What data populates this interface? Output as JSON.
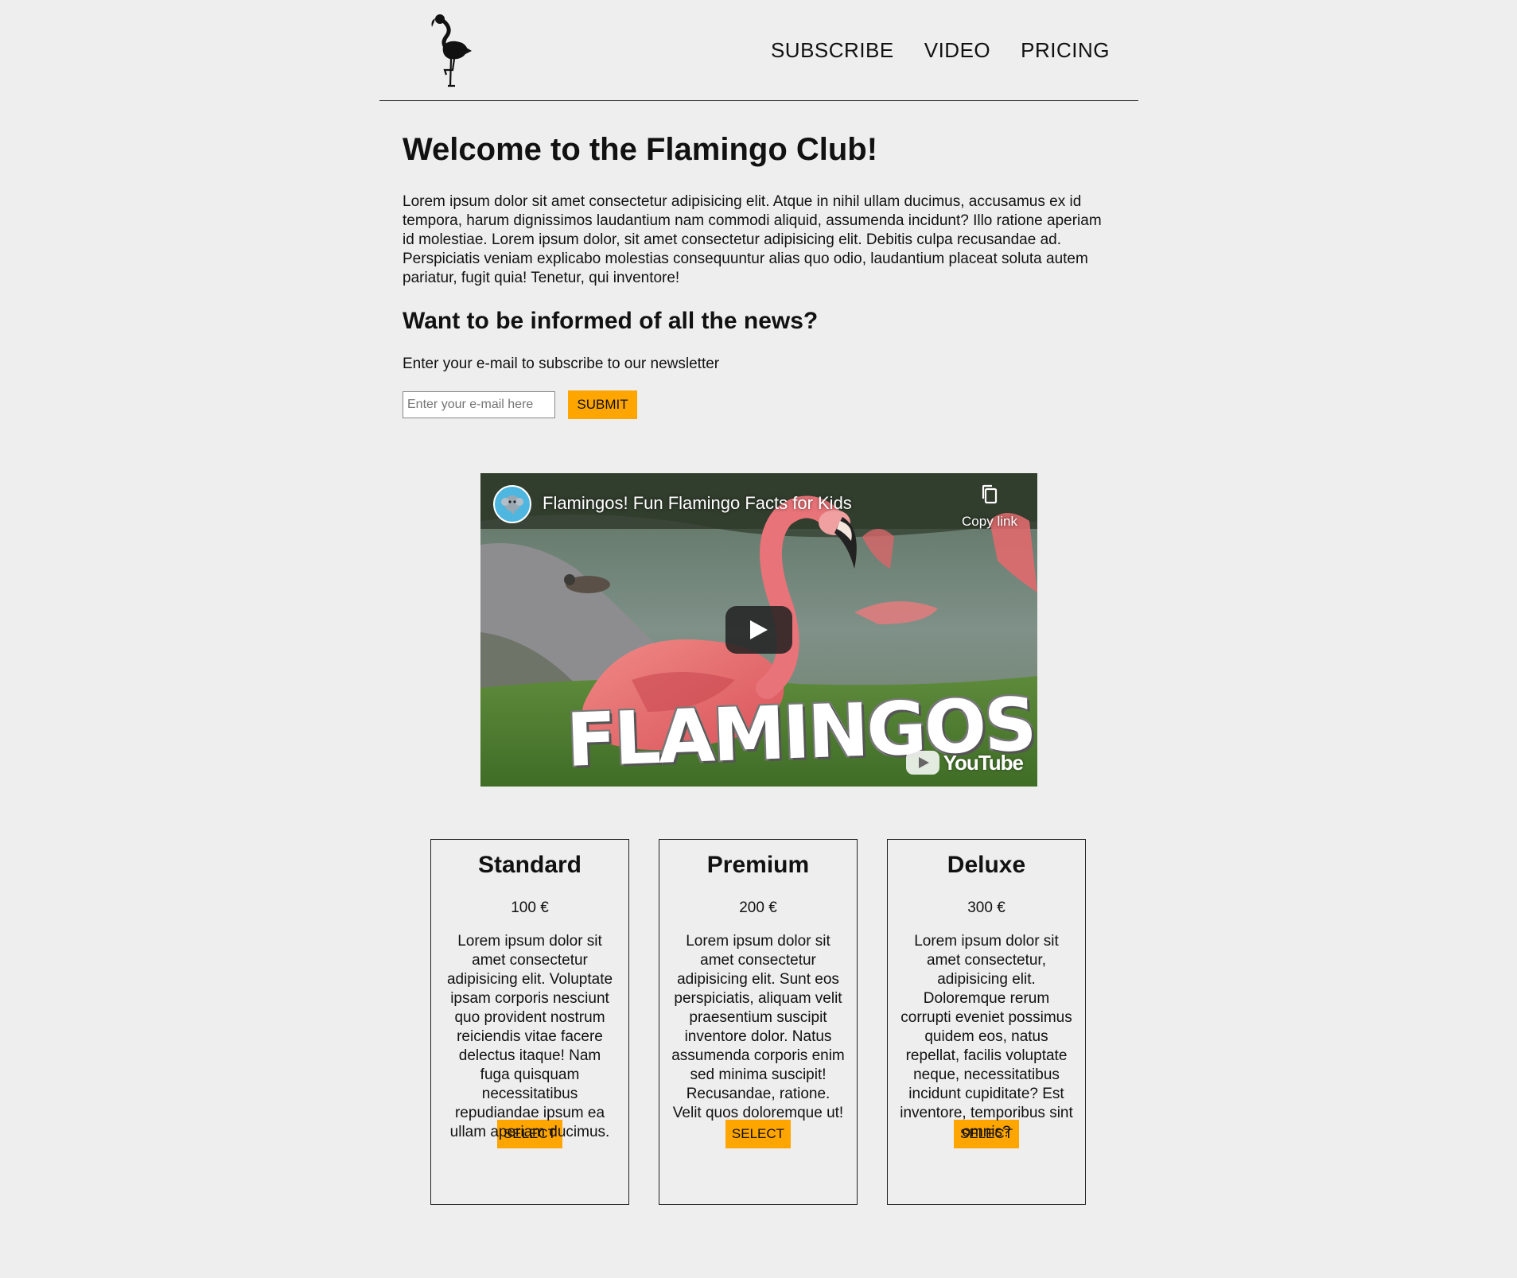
{
  "header": {
    "logo_icon": "flamingo-icon",
    "nav": [
      {
        "label": "SUBSCRIBE"
      },
      {
        "label": "VIDEO"
      },
      {
        "label": "PRICING"
      }
    ]
  },
  "main": {
    "title": "Welcome to the Flamingo Club!",
    "intro": "Lorem ipsum dolor sit amet consectetur adipisicing elit. Atque in nihil ullam ducimus, accusamus ex id tempora, harum dignissimos laudantium nam commodi aliquid, assumenda incidunt? Illo ratione aperiam id molestiae. Lorem ipsum dolor, sit amet consectetur adipisicing elit. Debitis culpa recusandae ad. Perspiciatis veniam explicabo molestias consequuntur alias quo odio, laudantium placeat soluta autem pariatur, fugit quia! Tenetur, qui inventore!",
    "news_title": "Want to be informed of all the news?",
    "newsletter_text": "Enter your e-mail to subscribe to our newsletter",
    "email_placeholder": "Enter your e-mail here",
    "email_value": "",
    "submit_label": "SUBMIT"
  },
  "video": {
    "title": "Flamingos! Fun Flamingo Facts for Kids",
    "copy_link_label": "Copy link",
    "overlay_title": "FLAMINGOS!",
    "youtube_label": "YouTube"
  },
  "pricing": [
    {
      "name": "Standard",
      "price": "100 €",
      "description": "Lorem ipsum dolor sit amet consectetur adipisicing elit. Voluptate ipsam corporis nesciunt quo provident nostrum reiciendis vitae facere delectus itaque! Nam fuga quisquam necessitatibus repudiandae ipsum ea ullam aperiam ducimus.",
      "button_label": "SELECT"
    },
    {
      "name": "Premium",
      "price": "200 €",
      "description": "Lorem ipsum dolor sit amet consectetur adipisicing elit. Sunt eos perspiciatis, aliquam velit praesentium suscipit inventore dolor. Natus assumenda corporis enim sed minima suscipit! Recusandae, ratione. Velit quos doloremque ut!",
      "button_label": "SELECT"
    },
    {
      "name": "Deluxe",
      "price": "300 €",
      "description": "Lorem ipsum dolor sit amet consectetur, adipisicing elit. Doloremque rerum corrupti eveniet possimus quidem eos, natus repellat, facilis voluptate neque, necessitatibus incidunt cupiditate? Est inventore, temporibus sint omnis?",
      "button_label": "SELECT"
    }
  ],
  "colors": {
    "background": "#eeeeee",
    "accent": "#ffa500",
    "text": "#111111"
  }
}
